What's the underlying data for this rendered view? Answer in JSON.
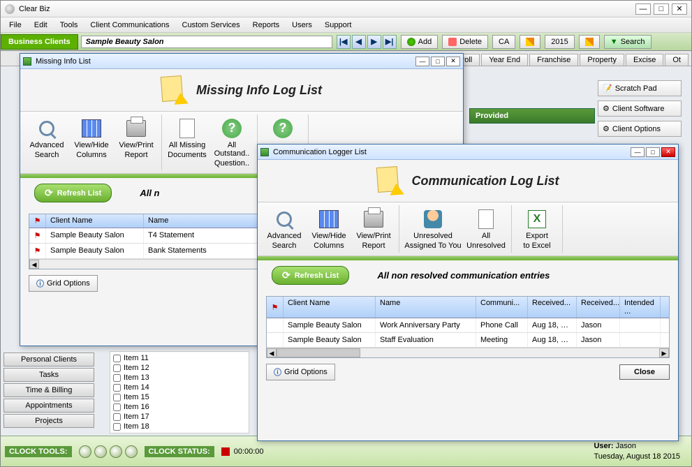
{
  "app": {
    "title": "Clear Biz"
  },
  "menu": [
    "File",
    "Edit",
    "Tools",
    "Client Communications",
    "Custom Services",
    "Reports",
    "Users",
    "Support"
  ],
  "toolbar": {
    "business_tab": "Business Clients",
    "client_name": "Sample Beauty Salon",
    "add": "Add",
    "delete": "Delete",
    "state": "CA",
    "year": "2015",
    "search": "Search"
  },
  "tabs": [
    "Payroll",
    "Year End",
    "Franchise",
    "Property",
    "Excise",
    "Ot"
  ],
  "right_buttons": [
    "Scratch Pad",
    "Client Software",
    "Client Options"
  ],
  "provided": "Provided",
  "left_nav": [
    "Personal Clients",
    "Tasks",
    "Time & Billing",
    "Appointments",
    "Projects"
  ],
  "item_list": [
    "Item 11",
    "Item 12",
    "Item 13",
    "Item 14",
    "Item 15",
    "Item 16",
    "Item 17",
    "Item 18"
  ],
  "clock": {
    "tools": "CLOCK TOOLS:",
    "status": "CLOCK STATUS:",
    "time": "00:00:00",
    "user_label": "User:",
    "user": "Jason",
    "date": "Tuesday, August 18 2015"
  },
  "dlg1": {
    "win_title": "Missing Info List",
    "heading": "Missing Info Log List",
    "tools": [
      {
        "label1": "Advanced",
        "label2": "Search"
      },
      {
        "label1": "View/Hide",
        "label2": "Columns"
      },
      {
        "label1": "View/Print",
        "label2": "Report"
      },
      {
        "label1": "All Missing",
        "label2": "Documents"
      },
      {
        "label1": "All Outstand..",
        "label2": "Question.."
      }
    ],
    "refresh": "Refresh List",
    "caption": "All n",
    "headers": {
      "client": "Client Name",
      "name": "Name"
    },
    "rows": [
      {
        "client": "Sample Beauty Salon",
        "name": "T4 Statement"
      },
      {
        "client": "Sample Beauty Salon",
        "name": "Bank Statements"
      }
    ],
    "grid_options": "Grid Options"
  },
  "dlg2": {
    "win_title": "Communication Logger List",
    "heading": "Communication Log List",
    "tools": [
      {
        "label1": "Advanced",
        "label2": "Search"
      },
      {
        "label1": "View/Hide",
        "label2": "Columns"
      },
      {
        "label1": "View/Print",
        "label2": "Report"
      },
      {
        "label1": "Unresolved",
        "label2": "Assigned To You"
      },
      {
        "label1": "All",
        "label2": "Unresolved"
      },
      {
        "label1": "Export",
        "label2": "to Excel"
      }
    ],
    "refresh": "Refresh List",
    "caption": "All non resolved communication entries",
    "headers": {
      "client": "Client Name",
      "name": "Name",
      "comm": "Communi...",
      "recv": "Received...",
      "recvby": "Received...",
      "intend": "Intended ..."
    },
    "rows": [
      {
        "client": "Sample Beauty Salon",
        "name": "Work Anniversary Party",
        "comm": "Phone Call",
        "recv": "Aug 18, 20...",
        "recvby": "Jason",
        "intend": ""
      },
      {
        "client": "Sample Beauty Salon",
        "name": "Staff Evaluation",
        "comm": "Meeting",
        "recv": "Aug 18, 20...",
        "recvby": "Jason",
        "intend": ""
      }
    ],
    "grid_options": "Grid Options",
    "close": "Close"
  }
}
